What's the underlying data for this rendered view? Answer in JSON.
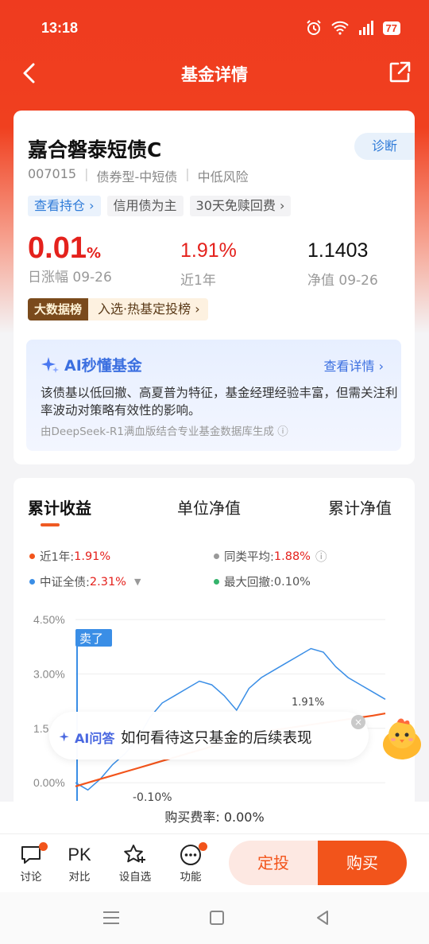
{
  "status": {
    "time": "13:18",
    "battery": "77"
  },
  "nav": {
    "title": "基金详情"
  },
  "fund": {
    "name": "嘉合磐泰短债C",
    "diagnose_label": "诊断",
    "code": "007015",
    "type": "债券型-中短债",
    "risk": "中低风险",
    "tags": [
      "查看持仓",
      "信用债为主",
      "30天免赎回费"
    ],
    "daily_change": {
      "value": "0.01",
      "unit": "%",
      "label": "日涨幅 09-26"
    },
    "yearly": {
      "value": "1.91%",
      "label": "近1年"
    },
    "nav_value": {
      "value": "1.1403",
      "label": "净值 09-26"
    },
    "rank_badge": "大数据榜",
    "rank_text": "入选·热基定投榜"
  },
  "ai": {
    "title": "AI秒懂基金",
    "link": "查看详情",
    "text": "该债基以低回撤、高夏普为特征，基金经理经验丰富，但需关注利率波动对策略有效性的影响。",
    "source": "由DeepSeek-R1满血版结合专业基金数据库生成"
  },
  "chart_section": {
    "tabs": [
      "累计收益",
      "单位净值",
      "累计净值"
    ],
    "legend": {
      "near_year_label": "近1年:",
      "near_year_value": "1.91%",
      "peer_label": "同类平均:",
      "peer_value": "1.88%",
      "index_label": "中证全债:",
      "index_value": "2.31%",
      "drawdown_label": "最大回撤:",
      "drawdown_value": "0.10%"
    },
    "colors": {
      "fund": "#f2541b",
      "peer": "#999999",
      "index": "#3a8ee6",
      "drawdown": "#34b36b"
    },
    "sell_tag": "卖了",
    "annot_min": "-0.10%",
    "annot_end": "1.91%"
  },
  "chart_data": {
    "type": "line",
    "yticks": [
      "4.50%",
      "3.00%",
      "1.5",
      "0.00%"
    ],
    "ylim": [
      -0.5,
      4.5
    ],
    "series": [
      {
        "name": "中证全债",
        "values": [
          0.0,
          -0.2,
          0.1,
          0.5,
          0.8,
          1.2,
          1.8,
          2.2,
          2.4,
          2.6,
          2.8,
          2.7,
          2.4,
          2.0,
          2.6,
          2.9,
          3.1,
          3.3,
          3.5,
          3.7,
          3.6,
          3.2,
          2.9,
          2.7,
          2.5,
          2.3
        ]
      },
      {
        "name": "近1年",
        "values": [
          -0.1,
          0.0,
          0.1,
          0.2,
          0.3,
          0.4,
          0.5,
          0.6,
          0.7,
          0.8,
          0.9,
          1.0,
          1.1,
          1.2,
          1.3,
          1.4,
          1.45,
          1.5,
          1.55,
          1.6,
          1.65,
          1.7,
          1.75,
          1.8,
          1.85,
          1.91
        ]
      }
    ]
  },
  "overlay": {
    "ai_tag": "AI问答",
    "question": "如何看待这只基金的后续表现",
    "close": "×"
  },
  "fee": {
    "text": "购买费率: 0.00%"
  },
  "bottom": {
    "discuss": "讨论",
    "pk": "PK",
    "compare": "对比",
    "watch": "设自选",
    "func": "功能",
    "dingtou": "定投",
    "buy": "购买"
  }
}
